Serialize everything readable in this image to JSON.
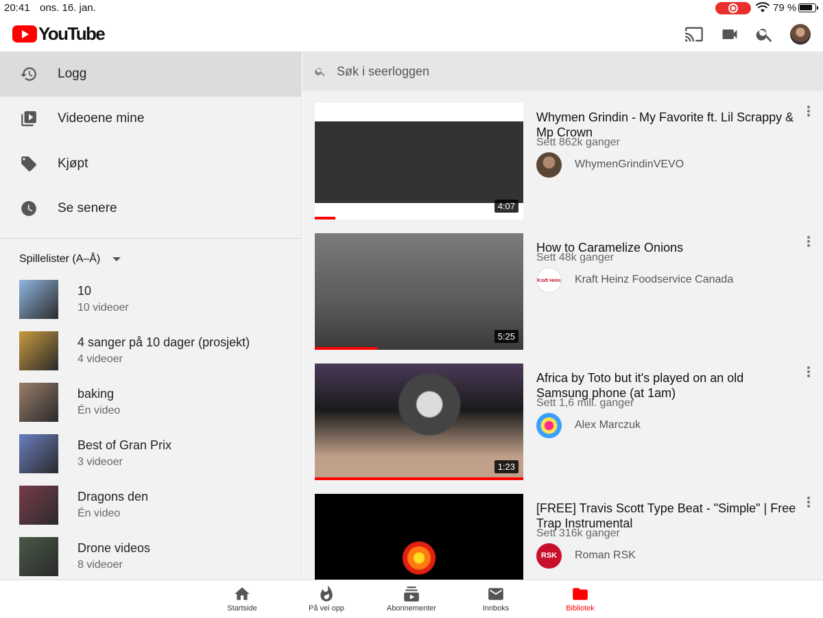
{
  "status_bar": {
    "time": "20:41",
    "date": "ons. 16. jan.",
    "battery": "79 %"
  },
  "app": {
    "name": "YouTube"
  },
  "topbar": {
    "icons": [
      "cast-icon",
      "camera-icon",
      "search-icon",
      "avatar"
    ]
  },
  "sidebar": {
    "nav": [
      {
        "label": "Logg",
        "icon": "history-icon",
        "active": true
      },
      {
        "label": "Videoene mine",
        "icon": "my-videos-icon",
        "active": false
      },
      {
        "label": "Kjøpt",
        "icon": "tag-icon",
        "active": false
      },
      {
        "label": "Se senere",
        "icon": "clock-icon",
        "active": false
      }
    ],
    "playlists_header": "Spillelister (A–Å)",
    "playlists": [
      {
        "title": "10",
        "count": "10 videoer",
        "thumb_color": "#8fb6e0"
      },
      {
        "title": "4 sanger på 10 dager (prosjekt)",
        "count": "4 videoer",
        "thumb_color": "#c89a3e"
      },
      {
        "title": "baking",
        "count": "Én video",
        "thumb_color": "#9a7d6a"
      },
      {
        "title": "Best of Gran Prix",
        "count": "3 videoer",
        "thumb_color": "#6a7ec0"
      },
      {
        "title": "Dragons den",
        "count": "Én video",
        "thumb_color": "#7a3c4c"
      },
      {
        "title": "Drone videos",
        "count": "8 videoer",
        "thumb_color": "#4a5a48"
      }
    ]
  },
  "main": {
    "search_placeholder": "Søk i seerloggen",
    "videos": [
      {
        "title": "Whymen Grindin - My Favorite ft. Lil Scrappy & Mp Crown",
        "views": "Sett 862k ganger",
        "channel": "WhymenGrindinVEVO",
        "duration": "4:07",
        "progress": 0.1
      },
      {
        "title": "How to Caramelize Onions",
        "views": "Sett 48k ganger",
        "channel": "Kraft Heinz Foodservice Canada",
        "channel_logo": "Kraft Heinz",
        "duration": "5:25",
        "progress": 0.3
      },
      {
        "title": "Africa by Toto but it's played on an old Samsung phone (at 1am)",
        "views": "Sett 1,6 mill. ganger",
        "channel": "Alex Marczuk",
        "duration": "1:23",
        "progress": 1.0
      },
      {
        "title": "[FREE] Travis Scott Type Beat - \"Simple\" | Free Trap Instrumental",
        "views": "Sett 316k ganger",
        "channel": "Roman RSK",
        "channel_logo": "RSK",
        "duration": "",
        "progress": 0
      }
    ]
  },
  "bottom_nav": [
    {
      "label": "Startside",
      "icon": "home-icon",
      "active": false
    },
    {
      "label": "På vei opp",
      "icon": "flame-icon",
      "active": false
    },
    {
      "label": "Abonnementer",
      "icon": "subscriptions-icon",
      "active": false
    },
    {
      "label": "Innboks",
      "icon": "mail-icon",
      "active": false
    },
    {
      "label": "Bibliotek",
      "icon": "folder-icon",
      "active": true
    }
  ],
  "colors": {
    "brand": "#ff0000",
    "sidebar_bg": "#f2f2f2",
    "active_nav_bg": "#dcdcdc"
  }
}
